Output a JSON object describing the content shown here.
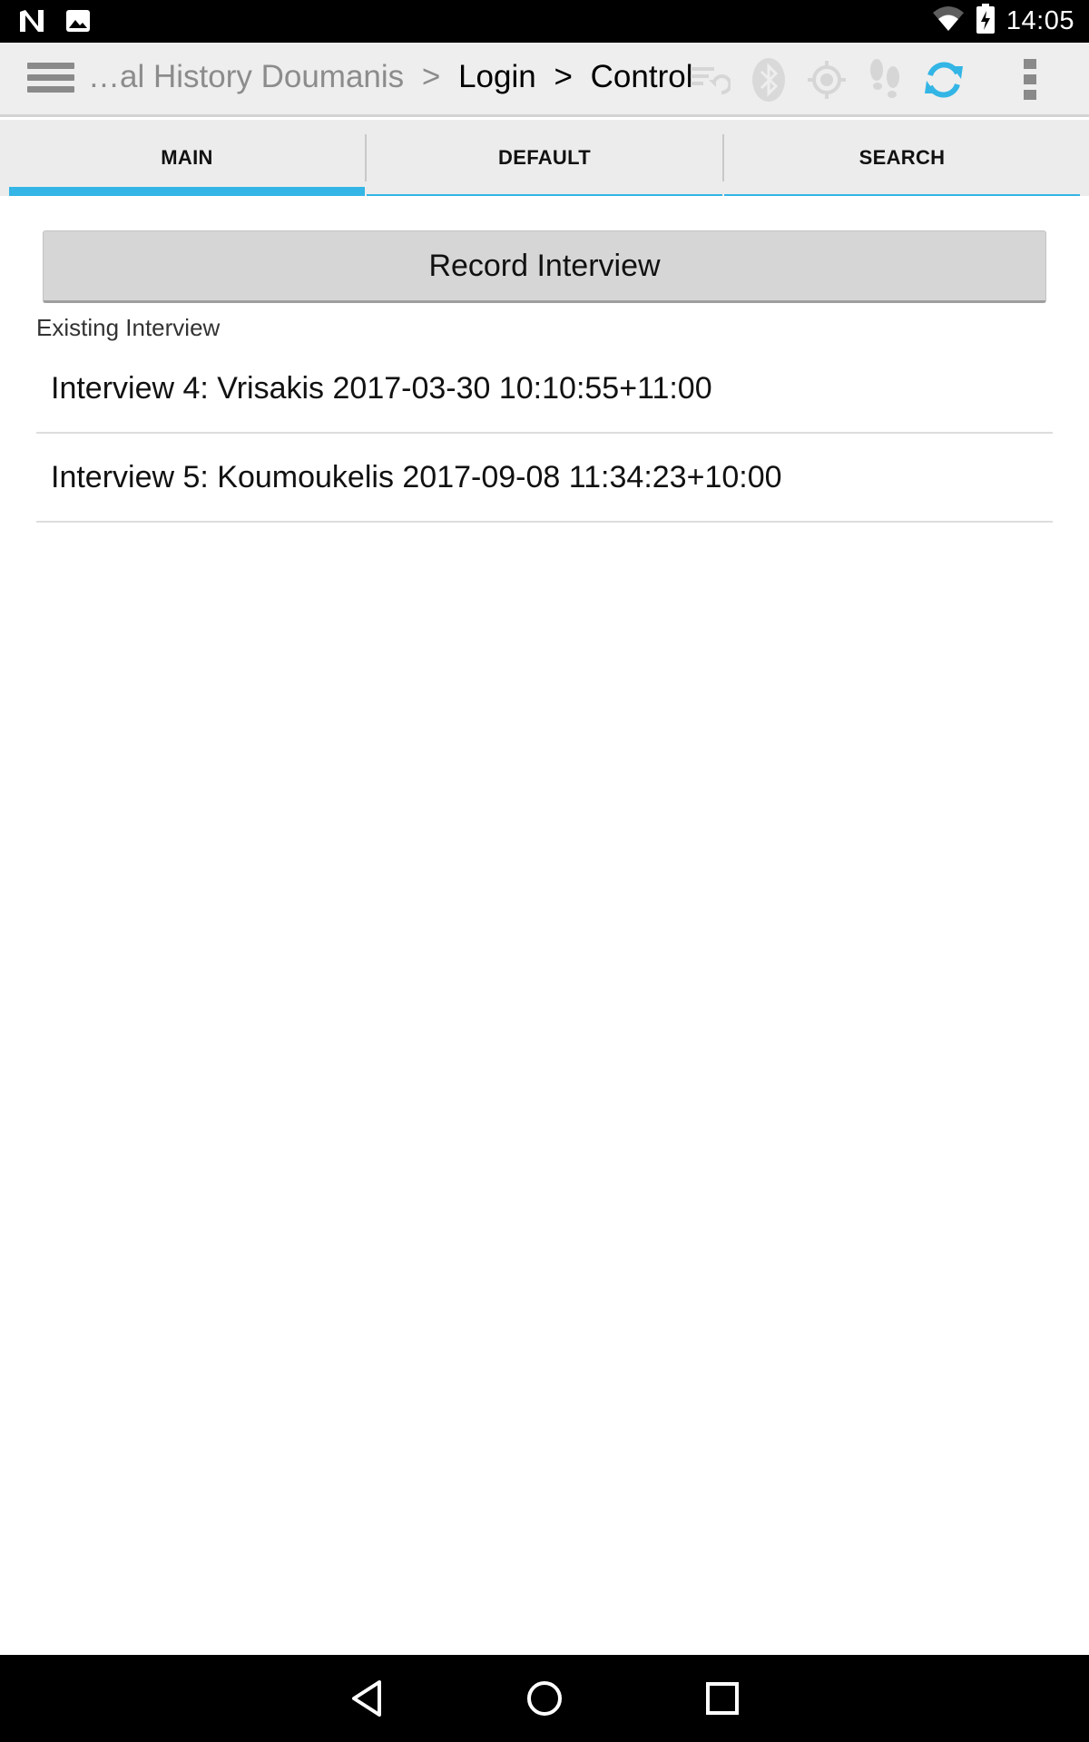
{
  "status_bar": {
    "time": "14:05",
    "icons": [
      "n-notification-icon",
      "image-notification-icon",
      "wifi-icon",
      "battery-charging-icon"
    ]
  },
  "action_bar": {
    "breadcrumb_dim": "…al History Doumanis",
    "separator": ">",
    "breadcrumb_login": "Login",
    "breadcrumb_control": "Control",
    "icons": [
      "menu-icon",
      "sync-list-icon",
      "bluetooth-icon",
      "gps-icon",
      "tracking-footsteps-icon",
      "sync-icon",
      "overflow-menu-icon"
    ],
    "accent_color": "#33b5e5"
  },
  "tabs": [
    {
      "label": "MAIN",
      "active": true
    },
    {
      "label": "DEFAULT",
      "active": false
    },
    {
      "label": "SEARCH",
      "active": false
    }
  ],
  "main": {
    "record_button_label": "Record Interview",
    "existing_label": "Existing Interview",
    "interviews": [
      {
        "label": "Interview 4: Vrisakis 2017-03-30 10:10:55+11:00"
      },
      {
        "label": "Interview 5: Koumoukelis 2017-09-08 11:34:23+10:00"
      }
    ]
  },
  "nav_bar": {
    "icons": [
      "back-icon",
      "home-icon",
      "recents-icon"
    ]
  }
}
